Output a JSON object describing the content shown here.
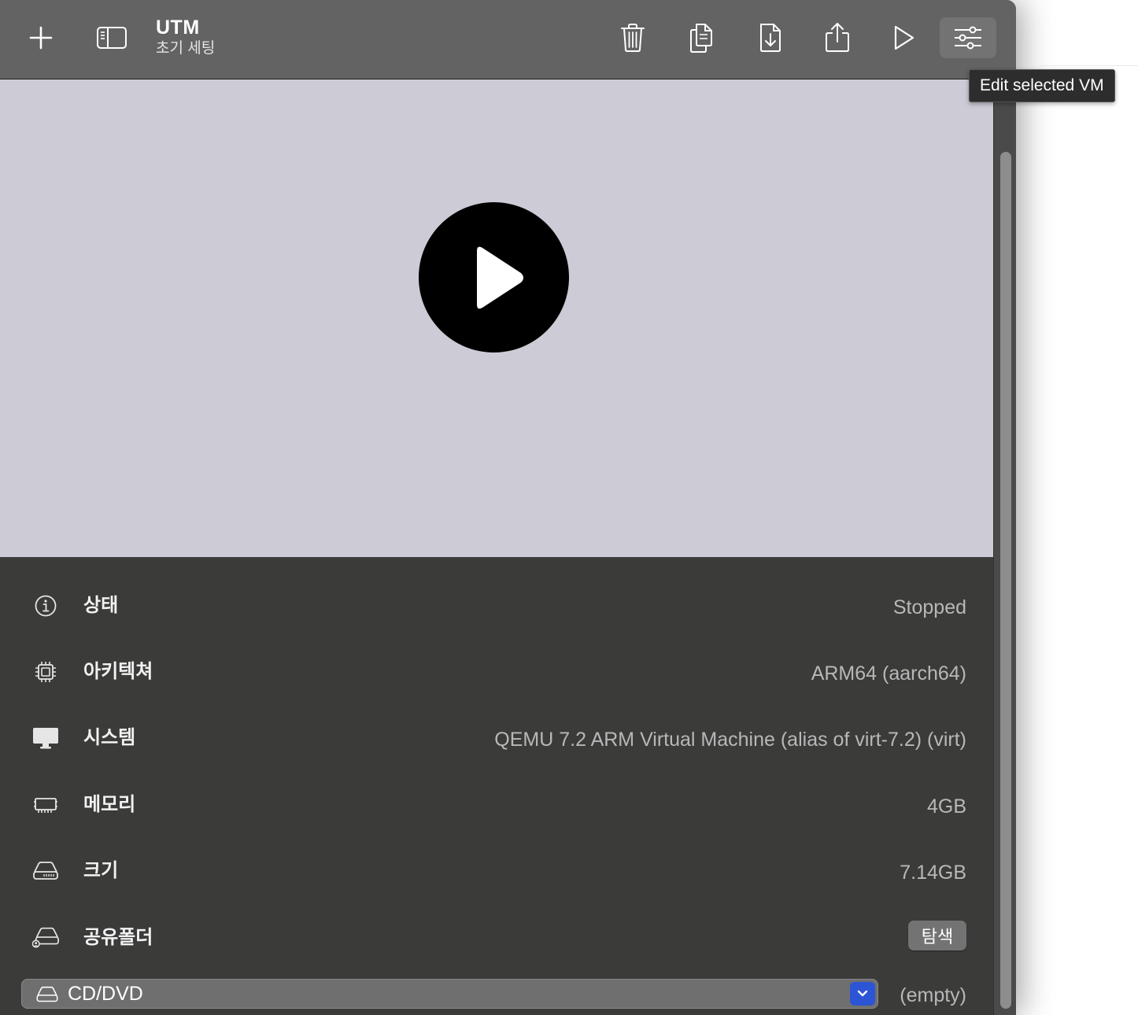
{
  "toolbar": {
    "add_icon": "plus-icon",
    "sidebar_icon": "sidebar-icon",
    "title": "UTM",
    "subtitle": "초기 세팅",
    "buttons": [
      {
        "name": "delete",
        "icon": "trash-icon"
      },
      {
        "name": "clone",
        "icon": "duplicate-icon"
      },
      {
        "name": "move",
        "icon": "download-doc-icon"
      },
      {
        "name": "share",
        "icon": "share-icon"
      },
      {
        "name": "run",
        "icon": "play-icon"
      },
      {
        "name": "edit",
        "icon": "sliders-icon"
      }
    ]
  },
  "tooltip": {
    "text": "Edit selected VM"
  },
  "preview": {
    "play_icon": "play-circle-icon",
    "background": "#cdcbd6"
  },
  "info": {
    "rows": [
      {
        "icon": "info-icon",
        "label": "상태",
        "value": "Stopped"
      },
      {
        "icon": "cpu-icon",
        "label": "아키텍쳐",
        "value": "ARM64 (aarch64)"
      },
      {
        "icon": "display-icon",
        "label": "시스템",
        "value": "QEMU 7.2 ARM Virtual Machine (alias of virt-7.2) (virt)"
      },
      {
        "icon": "memory-icon",
        "label": "메모리",
        "value": "4GB"
      },
      {
        "icon": "drive-icon",
        "label": "크기",
        "value": "7.14GB"
      },
      {
        "icon": "shared-folder-icon",
        "label": "공유폴더",
        "button": "탐색"
      }
    ],
    "cd_drive": {
      "icon": "drive-icon",
      "label": "CD/DVD",
      "value": "(empty)"
    }
  },
  "colors": {
    "accent": "#2c55d6",
    "toolbar": "#636364",
    "panel": "#3b3b3a"
  }
}
